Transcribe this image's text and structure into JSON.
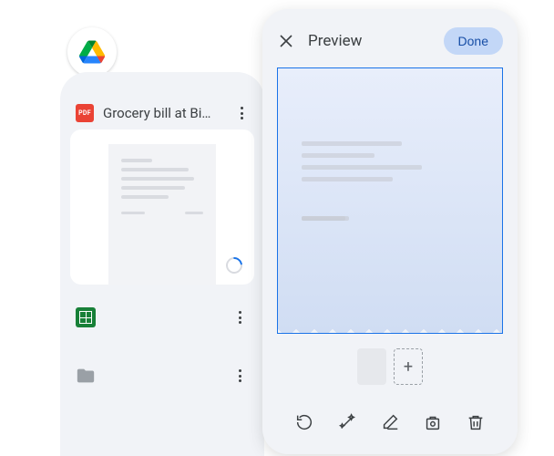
{
  "drive": {
    "file": {
      "badge_label": "PDF",
      "title": "Grocery bill at Bi…"
    }
  },
  "preview": {
    "title": "Preview",
    "done_label": "Done",
    "add_page_glyph": "+"
  }
}
